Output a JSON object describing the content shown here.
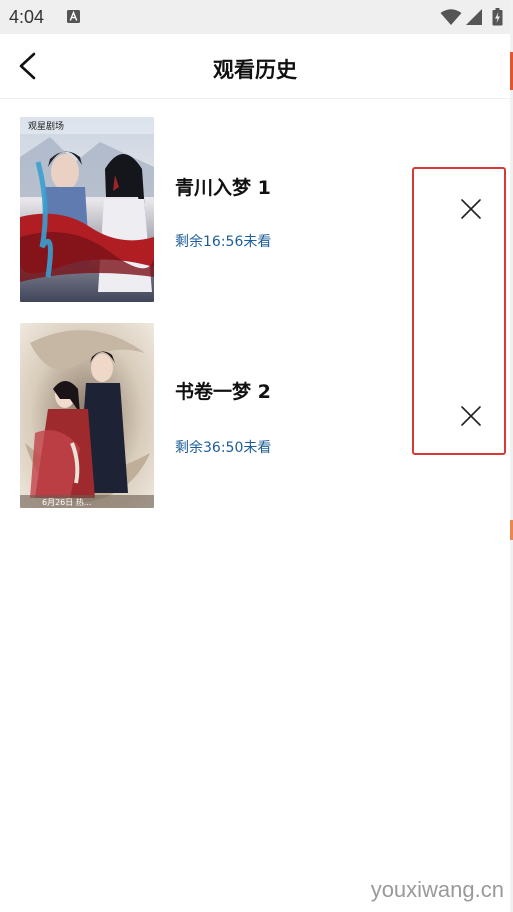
{
  "status_bar": {
    "time": "4:04",
    "icons": [
      "keyboard-a-icon",
      "wifi-icon",
      "signal-icon",
      "battery-icon"
    ]
  },
  "header": {
    "title": "观看历史",
    "back_icon": "chevron-left-icon"
  },
  "history": [
    {
      "title": "青川入梦 1",
      "progress": "剩余16:56未看",
      "poster_caption": "观星剧场",
      "delete_icon": "close-icon"
    },
    {
      "title": "书卷一梦 2",
      "progress": "剩余36:50未看",
      "poster_caption": "6月26日 热...",
      "delete_icon": "close-icon"
    }
  ],
  "watermark": "youxiwang.cn",
  "colors": {
    "accent_progress": "#1d5e9a",
    "highlight_box": "#d63a35"
  }
}
